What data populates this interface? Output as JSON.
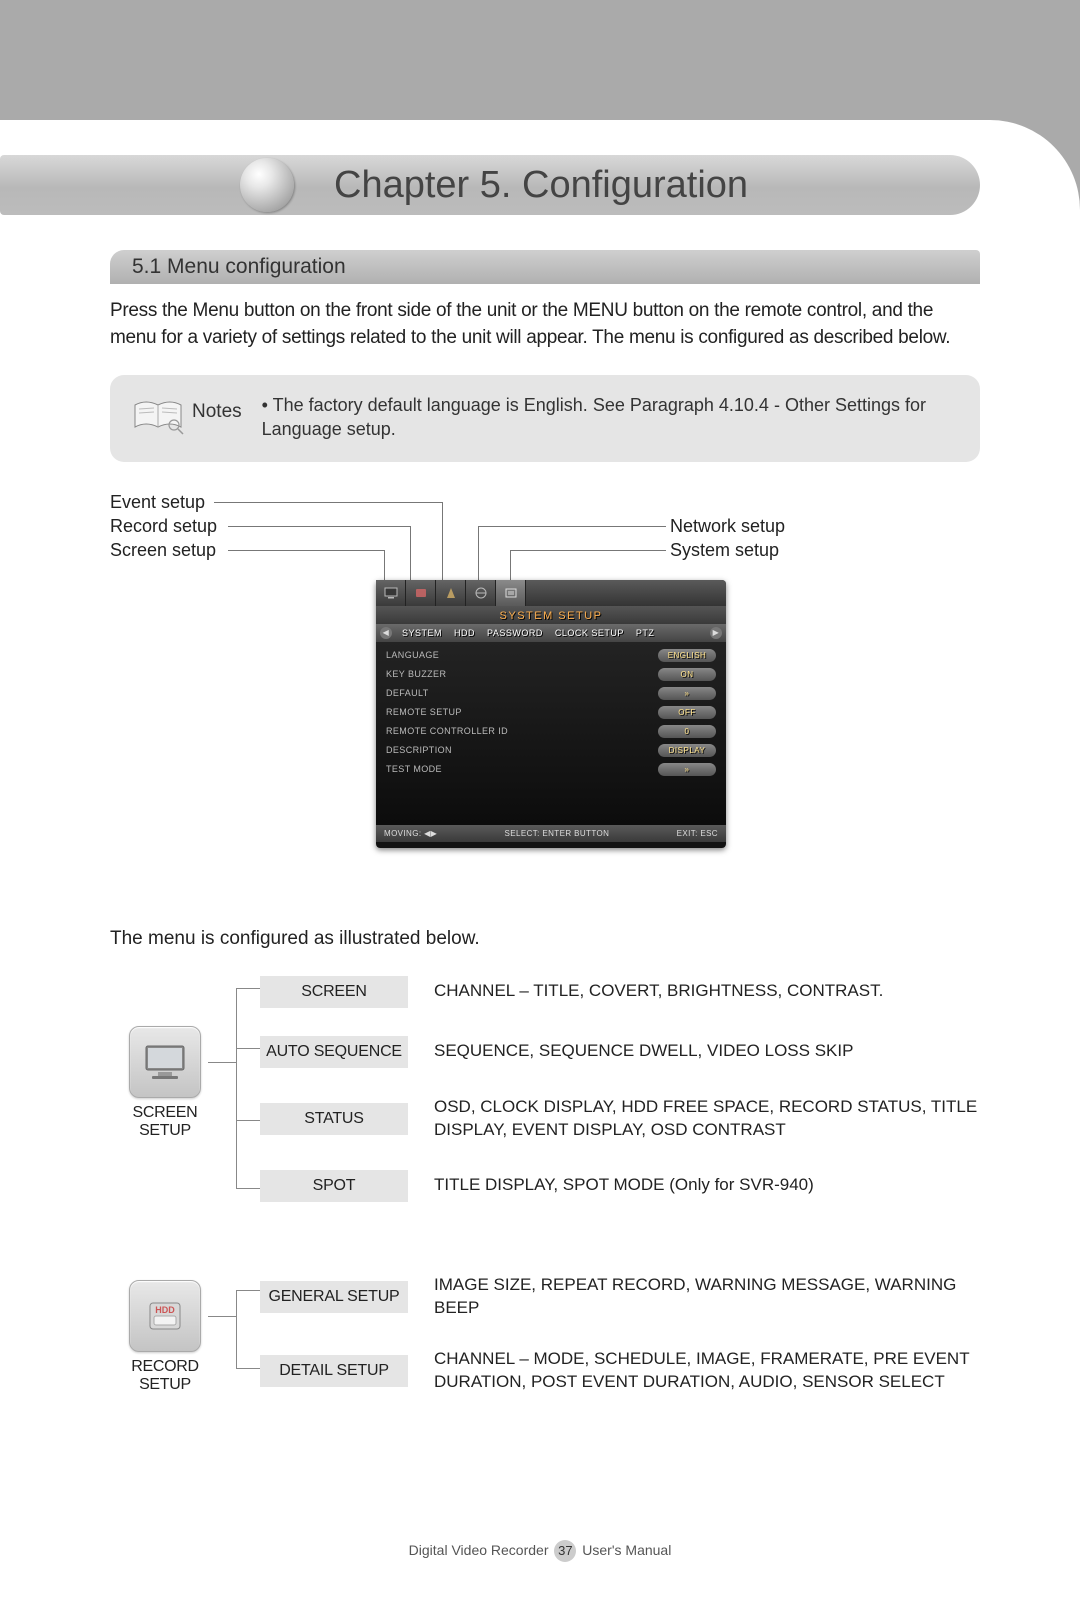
{
  "chapter": {
    "title": "Chapter 5. Configuration"
  },
  "section": {
    "number_title": "5.1 Menu configuration"
  },
  "intro": "Press the Menu button on the front side of the unit or the MENU button on the remote control, and the menu for a variety of settings related to the unit will appear. The menu is configured as described below.",
  "notes": {
    "label": "Notes",
    "text": "• The factory default language is English. See Paragraph 4.10.4 - Other Settings for Language setup."
  },
  "callouts": {
    "left": [
      "Event setup",
      "Record setup",
      "Screen setup"
    ],
    "right": [
      "Network setup",
      "System setup"
    ]
  },
  "osd": {
    "title": "SYSTEM SETUP",
    "subtabs": [
      "SYSTEM",
      "HDD",
      "PASSWORD",
      "CLOCK SETUP",
      "PTZ"
    ],
    "rows": [
      {
        "label": "LANGUAGE",
        "value": "ENGLISH"
      },
      {
        "label": "KEY BUZZER",
        "value": "ON"
      },
      {
        "label": "DEFAULT",
        "value": "»"
      },
      {
        "label": "REMOTE SETUP",
        "value": "OFF"
      },
      {
        "label": "REMOTE CONTROLLER ID",
        "value": "0"
      },
      {
        "label": "DESCRIPTION",
        "value": "DISPLAY"
      },
      {
        "label": "TEST MODE",
        "value": "»"
      }
    ],
    "footer": {
      "moving": "MOVING: ◀▶",
      "select": "SELECT: ENTER BUTTON",
      "exit": "EXIT: ESC"
    }
  },
  "para2": "The menu is configured as illustrated below.",
  "tree": [
    {
      "icon": "monitor",
      "caption": "SCREEN SETUP",
      "rows": [
        {
          "chip": "SCREEN",
          "desc": "CHANNEL – TITLE, COVERT, BRIGHTNESS, CONTRAST."
        },
        {
          "chip": "AUTO SEQUENCE",
          "desc": "SEQUENCE, SEQUENCE DWELL, VIDEO LOSS SKIP"
        },
        {
          "chip": "STATUS",
          "desc": "OSD, CLOCK DISPLAY, HDD FREE SPACE, RECORD STATUS, TITLE DISPLAY, EVENT DISPLAY, OSD CONTRAST"
        },
        {
          "chip": "SPOT",
          "desc": "TITLE DISPLAY, SPOT MODE (Only for SVR-940)"
        }
      ]
    },
    {
      "icon": "hdd",
      "caption": "RECORD SETUP",
      "rows": [
        {
          "chip": "GENERAL SETUP",
          "desc": "IMAGE SIZE, REPEAT RECORD, WARNING MESSAGE, WARNING BEEP"
        },
        {
          "chip": "DETAIL SETUP",
          "desc": "CHANNEL – MODE, SCHEDULE, IMAGE, FRAMERATE, PRE EVENT DURATION, POST EVENT DURATION, AUDIO, SENSOR SELECT"
        }
      ]
    }
  ],
  "footer": {
    "prefix": "Digital Video Recorder",
    "page": "37",
    "suffix": "User's Manual"
  }
}
